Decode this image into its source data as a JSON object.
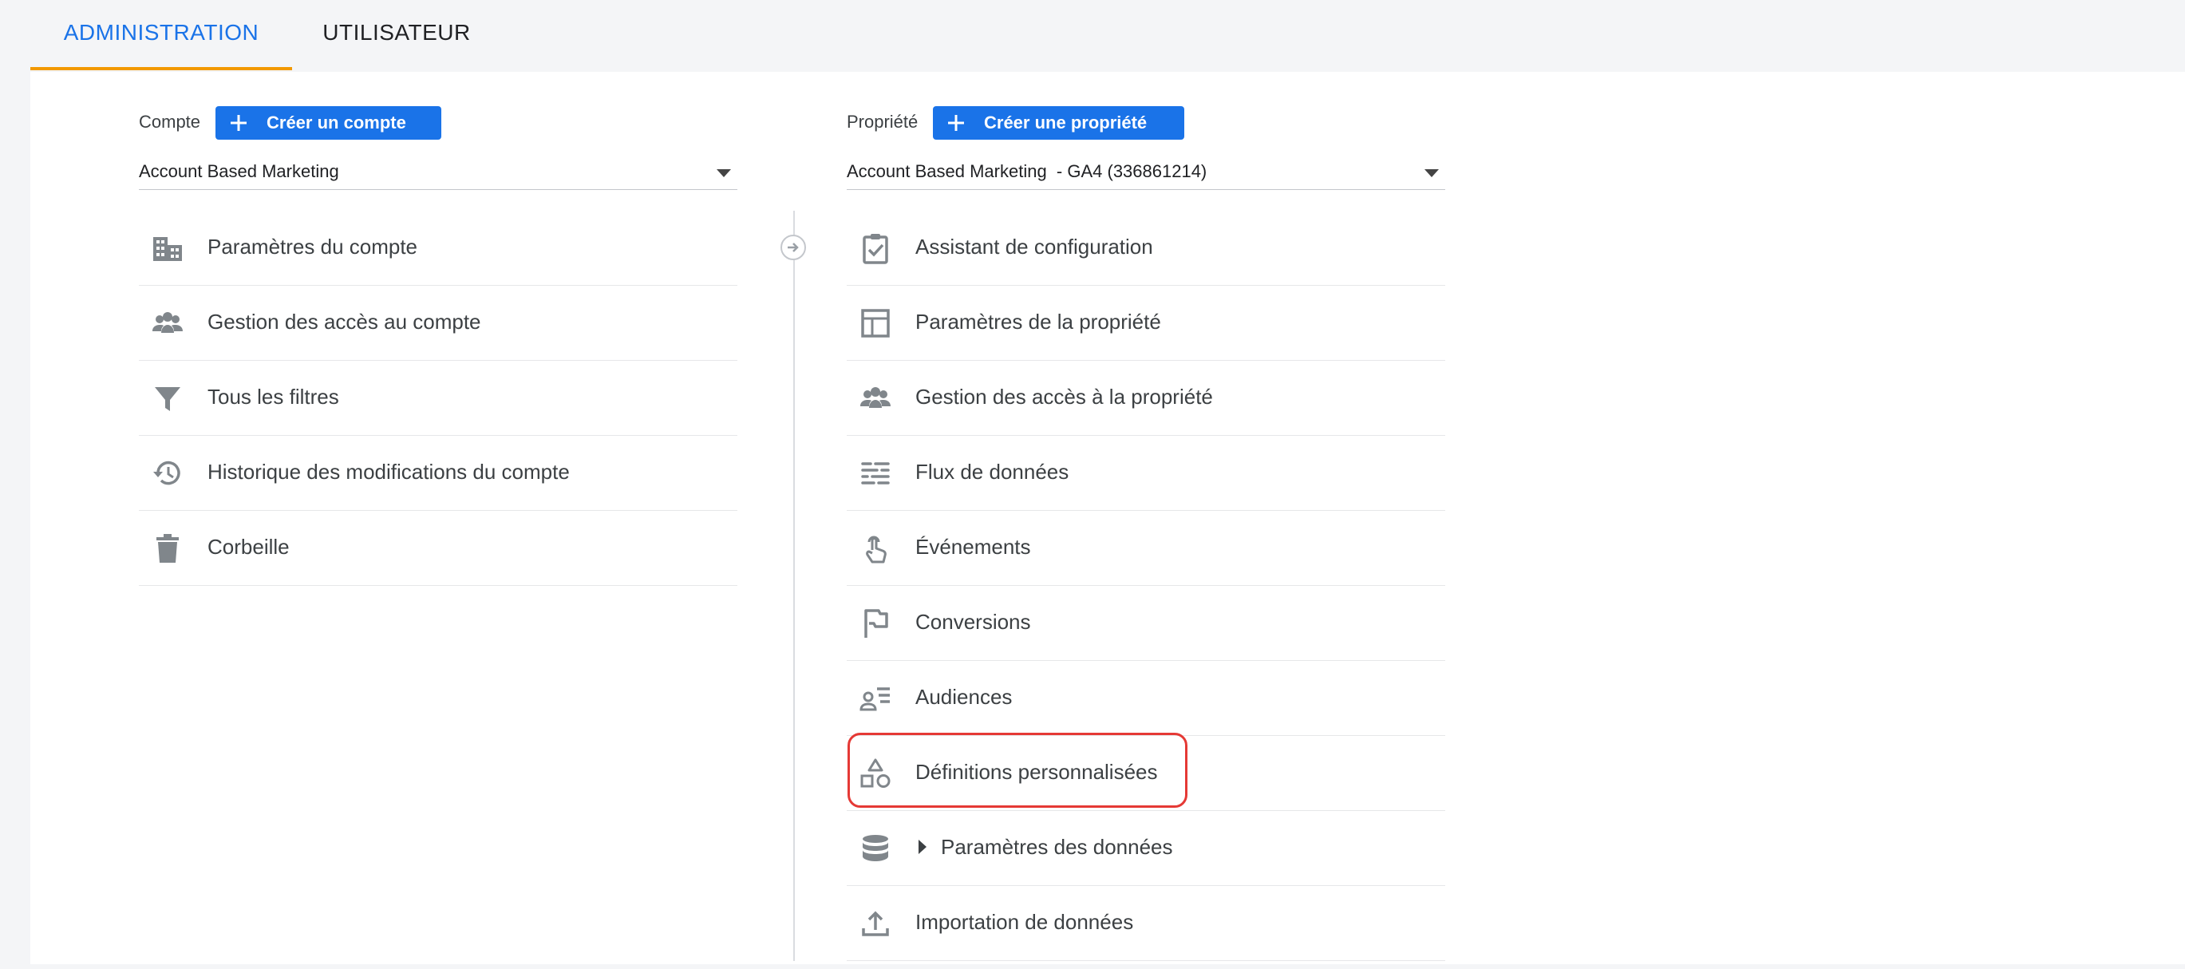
{
  "tabs": [
    {
      "label": "ADMINISTRATION",
      "active": true
    },
    {
      "label": "UTILISATEUR",
      "active": false
    }
  ],
  "account": {
    "label": "Compte",
    "create_button": "Créer un compte",
    "selected": "Account Based Marketing",
    "menu": [
      {
        "icon": "building-icon",
        "label": "Paramètres du compte"
      },
      {
        "icon": "people-icon",
        "label": "Gestion des accès au compte"
      },
      {
        "icon": "filter-icon",
        "label": "Tous les filtres"
      },
      {
        "icon": "history-icon",
        "label": "Historique des modifications du compte"
      },
      {
        "icon": "trash-icon",
        "label": "Corbeille"
      }
    ]
  },
  "property": {
    "label": "Propriété",
    "create_button": "Créer une propriété",
    "selected": "Account Based Marketing  - GA4 (336861214)",
    "menu": [
      {
        "icon": "checklist-icon",
        "label": "Assistant de configuration"
      },
      {
        "icon": "layout-icon",
        "label": "Paramètres de la propriété"
      },
      {
        "icon": "people-icon",
        "label": "Gestion des accès à la propriété"
      },
      {
        "icon": "data-stream-icon",
        "label": "Flux de données"
      },
      {
        "icon": "touch-icon",
        "label": "Événements"
      },
      {
        "icon": "flag-icon",
        "label": "Conversions"
      },
      {
        "icon": "audience-icon",
        "label": "Audiences"
      },
      {
        "icon": "shapes-icon",
        "label": "Définitions personnalisées",
        "highlighted": true
      },
      {
        "icon": "database-icon",
        "label": "Paramètres des données",
        "expandable": true
      },
      {
        "icon": "upload-icon",
        "label": "Importation de données"
      }
    ]
  },
  "colors": {
    "accent": "#1a73e8",
    "tab_underline": "#f29900",
    "highlight": "#e53935"
  }
}
